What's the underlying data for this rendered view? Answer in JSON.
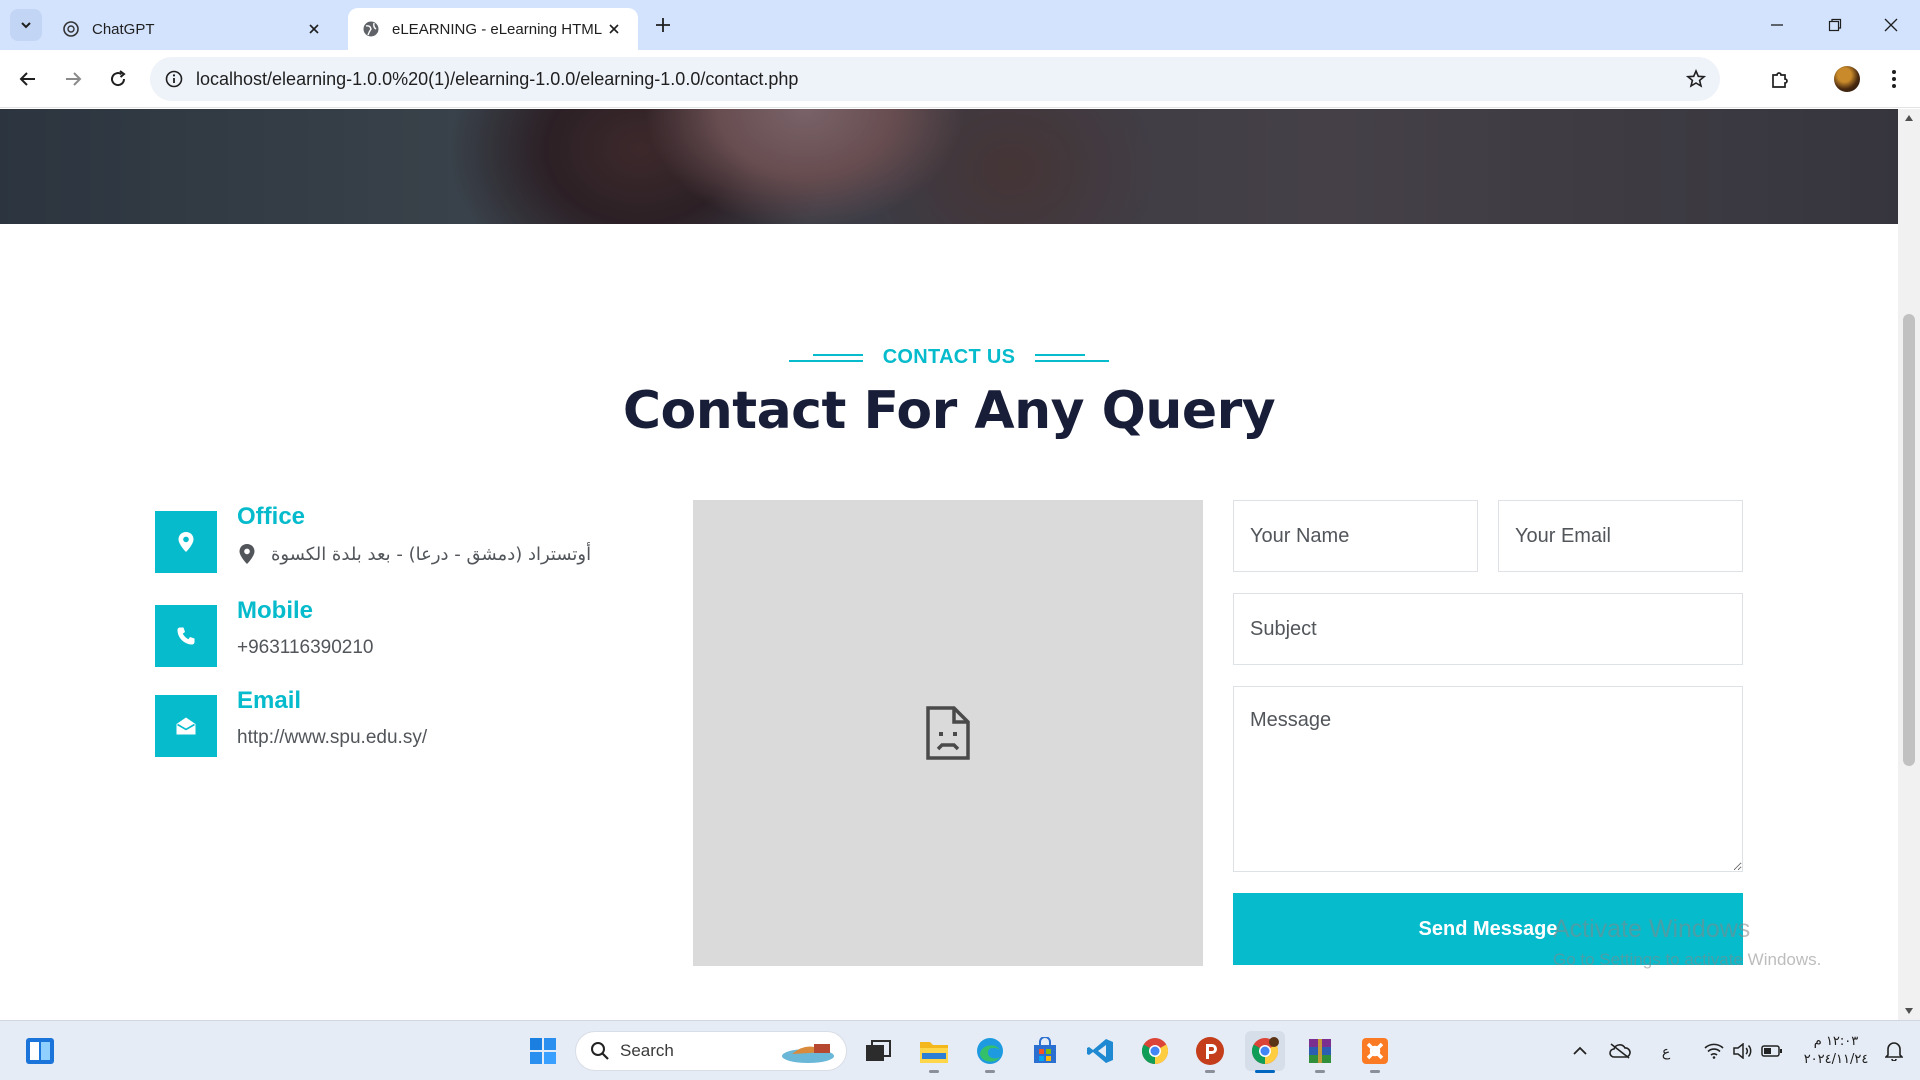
{
  "browser": {
    "tabs": [
      {
        "title": "ChatGPT",
        "icon": "chatgpt-icon",
        "active": false
      },
      {
        "title": "eLEARNING - eLearning HTML",
        "icon": "globe-icon",
        "active": true
      }
    ],
    "url": "localhost/elearning-1.0.0%20(1)/elearning-1.0.0/elearning-1.0.0/contact.php"
  },
  "section": {
    "tag": "CONTACT US",
    "title": "Contact For Any Query"
  },
  "contact": {
    "office": {
      "heading": "Office",
      "value": "أوتستراد (دمشق - درعا) - بعد بلدة الكسوة",
      "icon": "map-marker-icon"
    },
    "mobile": {
      "heading": "Mobile",
      "value": "+963116390210",
      "icon": "phone-icon"
    },
    "email": {
      "heading": "Email",
      "value": "http://www.spu.edu.sy/",
      "icon": "envelope-open-icon"
    }
  },
  "map": {
    "state": "failed-to-load",
    "icon": "broken-document-icon"
  },
  "form": {
    "name_placeholder": "Your Name",
    "email_placeholder": "Your Email",
    "subject_placeholder": "Subject",
    "message_placeholder": "Message",
    "submit_label": "Send Message"
  },
  "watermark": {
    "line1": "Activate Windows",
    "line2": "Go to Settings to activate Windows."
  },
  "taskbar": {
    "search_label": "Search",
    "apps": [
      "file-explorer-icon",
      "edge-icon",
      "microsoft-store-icon",
      "vscode-icon",
      "chrome-icon",
      "powerpoint-icon",
      "chrome-profile-icon",
      "winrar-icon",
      "xampp-icon"
    ],
    "tray": {
      "language": "ع"
    },
    "clock": {
      "time": "١٢:٠٣ م",
      "date": "٢٠٢٤/١١/٢٤"
    }
  },
  "colors": {
    "accent": "#06bbcc",
    "heading": "#181d38",
    "text": "#52565b"
  }
}
